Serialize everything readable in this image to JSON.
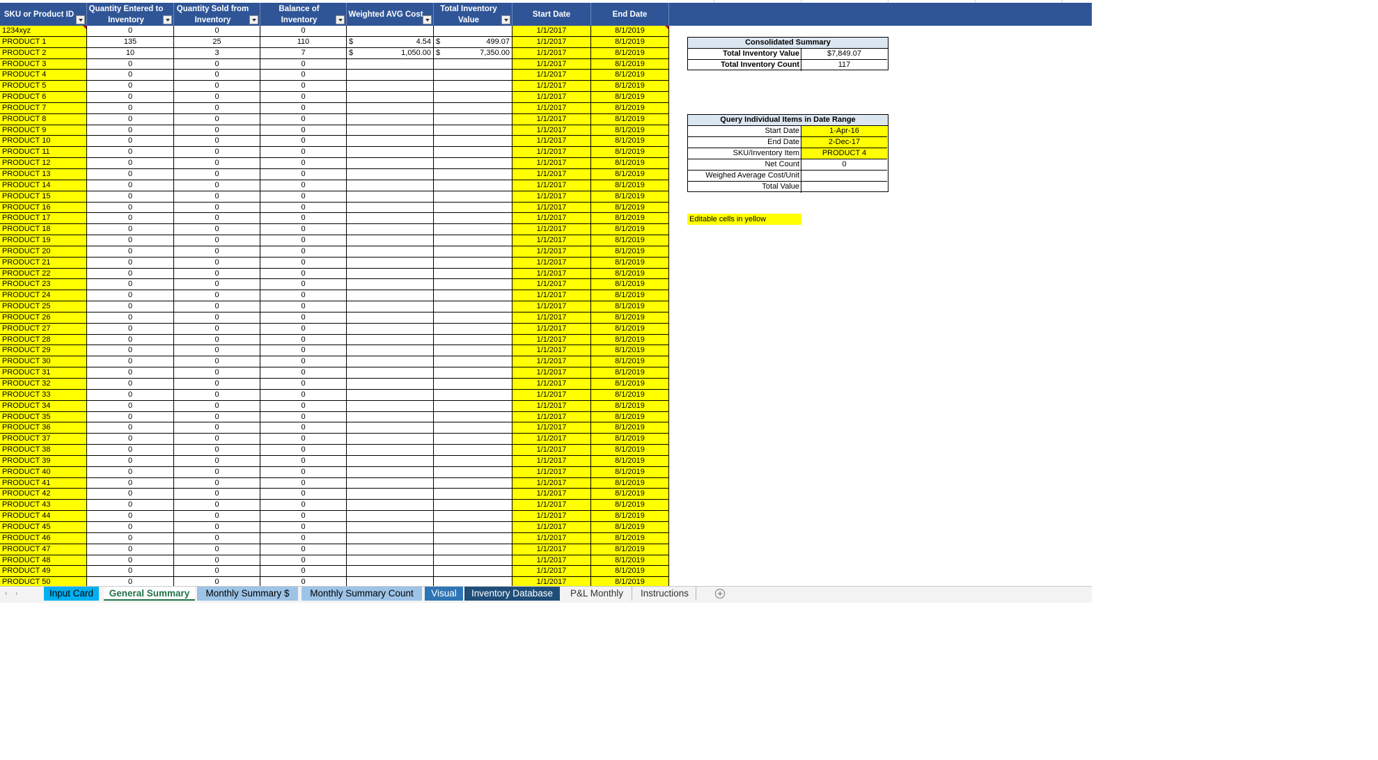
{
  "headers": [
    {
      "label": "SKU or Product ID",
      "filter": true
    },
    {
      "label": "Quantity Entered to Inventory",
      "filter": true
    },
    {
      "label": "Quantity Sold from Inventory",
      "filter": true
    },
    {
      "label": "Balance of Inventory",
      "filter": true
    },
    {
      "label": "Weighted AVG Cost",
      "filter": true
    },
    {
      "label": "Total Inventory Value",
      "filter": true
    },
    {
      "label": "Start Date",
      "filter": false
    },
    {
      "label": "End Date",
      "filter": false
    }
  ],
  "rows": [
    {
      "sku": "1234xyz",
      "entered": "0",
      "sold": "0",
      "balance": "0",
      "wac_sym": "",
      "wac": "",
      "tiv_sym": "",
      "tiv": "",
      "start": "1/1/2017",
      "end": "8/1/2019"
    },
    {
      "sku": "PRODUCT 1",
      "entered": "135",
      "sold": "25",
      "balance": "110",
      "wac_sym": "$",
      "wac": "4.54",
      "tiv_sym": "$",
      "tiv": "499.07",
      "start": "1/1/2017",
      "end": "8/1/2019"
    },
    {
      "sku": "PRODUCT 2",
      "entered": "10",
      "sold": "3",
      "balance": "7",
      "wac_sym": "$",
      "wac": "1,050.00",
      "tiv_sym": "$",
      "tiv": "7,350.00",
      "start": "1/1/2017",
      "end": "8/1/2019"
    },
    {
      "sku": "PRODUCT 3",
      "entered": "0",
      "sold": "0",
      "balance": "0",
      "wac_sym": "",
      "wac": "",
      "tiv_sym": "",
      "tiv": "",
      "start": "1/1/2017",
      "end": "8/1/2019"
    },
    {
      "sku": "PRODUCT 4",
      "entered": "0",
      "sold": "0",
      "balance": "0",
      "wac_sym": "",
      "wac": "",
      "tiv_sym": "",
      "tiv": "",
      "start": "1/1/2017",
      "end": "8/1/2019"
    },
    {
      "sku": "PRODUCT 5",
      "entered": "0",
      "sold": "0",
      "balance": "0",
      "wac_sym": "",
      "wac": "",
      "tiv_sym": "",
      "tiv": "",
      "start": "1/1/2017",
      "end": "8/1/2019"
    },
    {
      "sku": "PRODUCT 6",
      "entered": "0",
      "sold": "0",
      "balance": "0",
      "wac_sym": "",
      "wac": "",
      "tiv_sym": "",
      "tiv": "",
      "start": "1/1/2017",
      "end": "8/1/2019"
    },
    {
      "sku": "PRODUCT 7",
      "entered": "0",
      "sold": "0",
      "balance": "0",
      "wac_sym": "",
      "wac": "",
      "tiv_sym": "",
      "tiv": "",
      "start": "1/1/2017",
      "end": "8/1/2019"
    },
    {
      "sku": "PRODUCT 8",
      "entered": "0",
      "sold": "0",
      "balance": "0",
      "wac_sym": "",
      "wac": "",
      "tiv_sym": "",
      "tiv": "",
      "start": "1/1/2017",
      "end": "8/1/2019"
    },
    {
      "sku": "PRODUCT 9",
      "entered": "0",
      "sold": "0",
      "balance": "0",
      "wac_sym": "",
      "wac": "",
      "tiv_sym": "",
      "tiv": "",
      "start": "1/1/2017",
      "end": "8/1/2019"
    },
    {
      "sku": "PRODUCT 10",
      "entered": "0",
      "sold": "0",
      "balance": "0",
      "wac_sym": "",
      "wac": "",
      "tiv_sym": "",
      "tiv": "",
      "start": "1/1/2017",
      "end": "8/1/2019"
    },
    {
      "sku": "PRODUCT 11",
      "entered": "0",
      "sold": "0",
      "balance": "0",
      "wac_sym": "",
      "wac": "",
      "tiv_sym": "",
      "tiv": "",
      "start": "1/1/2017",
      "end": "8/1/2019"
    },
    {
      "sku": "PRODUCT 12",
      "entered": "0",
      "sold": "0",
      "balance": "0",
      "wac_sym": "",
      "wac": "",
      "tiv_sym": "",
      "tiv": "",
      "start": "1/1/2017",
      "end": "8/1/2019"
    },
    {
      "sku": "PRODUCT 13",
      "entered": "0",
      "sold": "0",
      "balance": "0",
      "wac_sym": "",
      "wac": "",
      "tiv_sym": "",
      "tiv": "",
      "start": "1/1/2017",
      "end": "8/1/2019"
    },
    {
      "sku": "PRODUCT 14",
      "entered": "0",
      "sold": "0",
      "balance": "0",
      "wac_sym": "",
      "wac": "",
      "tiv_sym": "",
      "tiv": "",
      "start": "1/1/2017",
      "end": "8/1/2019"
    },
    {
      "sku": "PRODUCT 15",
      "entered": "0",
      "sold": "0",
      "balance": "0",
      "wac_sym": "",
      "wac": "",
      "tiv_sym": "",
      "tiv": "",
      "start": "1/1/2017",
      "end": "8/1/2019"
    },
    {
      "sku": "PRODUCT 16",
      "entered": "0",
      "sold": "0",
      "balance": "0",
      "wac_sym": "",
      "wac": "",
      "tiv_sym": "",
      "tiv": "",
      "start": "1/1/2017",
      "end": "8/1/2019"
    },
    {
      "sku": "PRODUCT 17",
      "entered": "0",
      "sold": "0",
      "balance": "0",
      "wac_sym": "",
      "wac": "",
      "tiv_sym": "",
      "tiv": "",
      "start": "1/1/2017",
      "end": "8/1/2019"
    },
    {
      "sku": "PRODUCT 18",
      "entered": "0",
      "sold": "0",
      "balance": "0",
      "wac_sym": "",
      "wac": "",
      "tiv_sym": "",
      "tiv": "",
      "start": "1/1/2017",
      "end": "8/1/2019"
    },
    {
      "sku": "PRODUCT 19",
      "entered": "0",
      "sold": "0",
      "balance": "0",
      "wac_sym": "",
      "wac": "",
      "tiv_sym": "",
      "tiv": "",
      "start": "1/1/2017",
      "end": "8/1/2019"
    },
    {
      "sku": "PRODUCT 20",
      "entered": "0",
      "sold": "0",
      "balance": "0",
      "wac_sym": "",
      "wac": "",
      "tiv_sym": "",
      "tiv": "",
      "start": "1/1/2017",
      "end": "8/1/2019"
    },
    {
      "sku": "PRODUCT 21",
      "entered": "0",
      "sold": "0",
      "balance": "0",
      "wac_sym": "",
      "wac": "",
      "tiv_sym": "",
      "tiv": "",
      "start": "1/1/2017",
      "end": "8/1/2019"
    },
    {
      "sku": "PRODUCT 22",
      "entered": "0",
      "sold": "0",
      "balance": "0",
      "wac_sym": "",
      "wac": "",
      "tiv_sym": "",
      "tiv": "",
      "start": "1/1/2017",
      "end": "8/1/2019"
    },
    {
      "sku": "PRODUCT 23",
      "entered": "0",
      "sold": "0",
      "balance": "0",
      "wac_sym": "",
      "wac": "",
      "tiv_sym": "",
      "tiv": "",
      "start": "1/1/2017",
      "end": "8/1/2019"
    },
    {
      "sku": "PRODUCT 24",
      "entered": "0",
      "sold": "0",
      "balance": "0",
      "wac_sym": "",
      "wac": "",
      "tiv_sym": "",
      "tiv": "",
      "start": "1/1/2017",
      "end": "8/1/2019"
    },
    {
      "sku": "PRODUCT 25",
      "entered": "0",
      "sold": "0",
      "balance": "0",
      "wac_sym": "",
      "wac": "",
      "tiv_sym": "",
      "tiv": "",
      "start": "1/1/2017",
      "end": "8/1/2019"
    },
    {
      "sku": "PRODUCT 26",
      "entered": "0",
      "sold": "0",
      "balance": "0",
      "wac_sym": "",
      "wac": "",
      "tiv_sym": "",
      "tiv": "",
      "start": "1/1/2017",
      "end": "8/1/2019"
    },
    {
      "sku": "PRODUCT 27",
      "entered": "0",
      "sold": "0",
      "balance": "0",
      "wac_sym": "",
      "wac": "",
      "tiv_sym": "",
      "tiv": "",
      "start": "1/1/2017",
      "end": "8/1/2019"
    },
    {
      "sku": "PRODUCT 28",
      "entered": "0",
      "sold": "0",
      "balance": "0",
      "wac_sym": "",
      "wac": "",
      "tiv_sym": "",
      "tiv": "",
      "start": "1/1/2017",
      "end": "8/1/2019"
    },
    {
      "sku": "PRODUCT 29",
      "entered": "0",
      "sold": "0",
      "balance": "0",
      "wac_sym": "",
      "wac": "",
      "tiv_sym": "",
      "tiv": "",
      "start": "1/1/2017",
      "end": "8/1/2019"
    },
    {
      "sku": "PRODUCT 30",
      "entered": "0",
      "sold": "0",
      "balance": "0",
      "wac_sym": "",
      "wac": "",
      "tiv_sym": "",
      "tiv": "",
      "start": "1/1/2017",
      "end": "8/1/2019"
    },
    {
      "sku": "PRODUCT 31",
      "entered": "0",
      "sold": "0",
      "balance": "0",
      "wac_sym": "",
      "wac": "",
      "tiv_sym": "",
      "tiv": "",
      "start": "1/1/2017",
      "end": "8/1/2019"
    },
    {
      "sku": "PRODUCT 32",
      "entered": "0",
      "sold": "0",
      "balance": "0",
      "wac_sym": "",
      "wac": "",
      "tiv_sym": "",
      "tiv": "",
      "start": "1/1/2017",
      "end": "8/1/2019"
    },
    {
      "sku": "PRODUCT 33",
      "entered": "0",
      "sold": "0",
      "balance": "0",
      "wac_sym": "",
      "wac": "",
      "tiv_sym": "",
      "tiv": "",
      "start": "1/1/2017",
      "end": "8/1/2019"
    },
    {
      "sku": "PRODUCT 34",
      "entered": "0",
      "sold": "0",
      "balance": "0",
      "wac_sym": "",
      "wac": "",
      "tiv_sym": "",
      "tiv": "",
      "start": "1/1/2017",
      "end": "8/1/2019"
    },
    {
      "sku": "PRODUCT 35",
      "entered": "0",
      "sold": "0",
      "balance": "0",
      "wac_sym": "",
      "wac": "",
      "tiv_sym": "",
      "tiv": "",
      "start": "1/1/2017",
      "end": "8/1/2019"
    },
    {
      "sku": "PRODUCT 36",
      "entered": "0",
      "sold": "0",
      "balance": "0",
      "wac_sym": "",
      "wac": "",
      "tiv_sym": "",
      "tiv": "",
      "start": "1/1/2017",
      "end": "8/1/2019"
    },
    {
      "sku": "PRODUCT 37",
      "entered": "0",
      "sold": "0",
      "balance": "0",
      "wac_sym": "",
      "wac": "",
      "tiv_sym": "",
      "tiv": "",
      "start": "1/1/2017",
      "end": "8/1/2019"
    },
    {
      "sku": "PRODUCT 38",
      "entered": "0",
      "sold": "0",
      "balance": "0",
      "wac_sym": "",
      "wac": "",
      "tiv_sym": "",
      "tiv": "",
      "start": "1/1/2017",
      "end": "8/1/2019"
    },
    {
      "sku": "PRODUCT 39",
      "entered": "0",
      "sold": "0",
      "balance": "0",
      "wac_sym": "",
      "wac": "",
      "tiv_sym": "",
      "tiv": "",
      "start": "1/1/2017",
      "end": "8/1/2019"
    },
    {
      "sku": "PRODUCT 40",
      "entered": "0",
      "sold": "0",
      "balance": "0",
      "wac_sym": "",
      "wac": "",
      "tiv_sym": "",
      "tiv": "",
      "start": "1/1/2017",
      "end": "8/1/2019"
    },
    {
      "sku": "PRODUCT 41",
      "entered": "0",
      "sold": "0",
      "balance": "0",
      "wac_sym": "",
      "wac": "",
      "tiv_sym": "",
      "tiv": "",
      "start": "1/1/2017",
      "end": "8/1/2019"
    },
    {
      "sku": "PRODUCT 42",
      "entered": "0",
      "sold": "0",
      "balance": "0",
      "wac_sym": "",
      "wac": "",
      "tiv_sym": "",
      "tiv": "",
      "start": "1/1/2017",
      "end": "8/1/2019"
    },
    {
      "sku": "PRODUCT 43",
      "entered": "0",
      "sold": "0",
      "balance": "0",
      "wac_sym": "",
      "wac": "",
      "tiv_sym": "",
      "tiv": "",
      "start": "1/1/2017",
      "end": "8/1/2019"
    },
    {
      "sku": "PRODUCT 44",
      "entered": "0",
      "sold": "0",
      "balance": "0",
      "wac_sym": "",
      "wac": "",
      "tiv_sym": "",
      "tiv": "",
      "start": "1/1/2017",
      "end": "8/1/2019"
    },
    {
      "sku": "PRODUCT 45",
      "entered": "0",
      "sold": "0",
      "balance": "0",
      "wac_sym": "",
      "wac": "",
      "tiv_sym": "",
      "tiv": "",
      "start": "1/1/2017",
      "end": "8/1/2019"
    },
    {
      "sku": "PRODUCT 46",
      "entered": "0",
      "sold": "0",
      "balance": "0",
      "wac_sym": "",
      "wac": "",
      "tiv_sym": "",
      "tiv": "",
      "start": "1/1/2017",
      "end": "8/1/2019"
    },
    {
      "sku": "PRODUCT 47",
      "entered": "0",
      "sold": "0",
      "balance": "0",
      "wac_sym": "",
      "wac": "",
      "tiv_sym": "",
      "tiv": "",
      "start": "1/1/2017",
      "end": "8/1/2019"
    },
    {
      "sku": "PRODUCT 48",
      "entered": "0",
      "sold": "0",
      "balance": "0",
      "wac_sym": "",
      "wac": "",
      "tiv_sym": "",
      "tiv": "",
      "start": "1/1/2017",
      "end": "8/1/2019"
    },
    {
      "sku": "PRODUCT 49",
      "entered": "0",
      "sold": "0",
      "balance": "0",
      "wac_sym": "",
      "wac": "",
      "tiv_sym": "",
      "tiv": "",
      "start": "1/1/2017",
      "end": "8/1/2019"
    },
    {
      "sku": "PRODUCT 50",
      "entered": "0",
      "sold": "0",
      "balance": "0",
      "wac_sym": "",
      "wac": "",
      "tiv_sym": "",
      "tiv": "",
      "start": "1/1/2017",
      "end": "8/1/2019"
    }
  ],
  "consolidated": {
    "title": "Consolidated Summary",
    "value_label": "Total Inventory Value",
    "value": "$7,849.07",
    "count_label": "Total Inventory Count",
    "count": "117"
  },
  "query": {
    "title": "Query Individual Items in Date Range",
    "start_label": "Start Date",
    "start": "1-Apr-16",
    "end_label": "End Date",
    "end": "2-Dec-17",
    "sku_label": "SKU/Inventory Item",
    "sku": "PRODUCT 4",
    "net_label": "Net Count",
    "net": "0",
    "wac_label": "Weighed Average Cost/Unit",
    "wac": "",
    "total_label": "Total Value",
    "total": ""
  },
  "note": "Editable cells in  yellow",
  "nav": {
    "prev": "‹",
    "next": "›"
  },
  "tabs": [
    {
      "label": "Input Card",
      "color": "#00b0f0",
      "text": "#000000"
    },
    {
      "label": "General Summary",
      "color": "#ffffff",
      "text": "#217346",
      "selected": true
    },
    {
      "label": "Monthly Summary $",
      "color": "#9dc3e6",
      "text": "#000000"
    },
    {
      "label": "Monthly Summary Count",
      "color": "#9dc3e6",
      "text": "#000000"
    },
    {
      "label": "Visual",
      "color": "#2e75b6",
      "text": "#ffffff"
    },
    {
      "label": "Inventory Database",
      "color": "#1f4e79",
      "text": "#ffffff"
    },
    {
      "label": "P&L Monthly",
      "color": "",
      "text": "#333333"
    },
    {
      "label": "Instructions",
      "color": "",
      "text": "#333333"
    }
  ],
  "add_sheet": "+",
  "colors": {
    "header": "#2f5597",
    "editable": "#ffff00",
    "box_title": "#dce6f1",
    "selected_tab": "#217346"
  }
}
